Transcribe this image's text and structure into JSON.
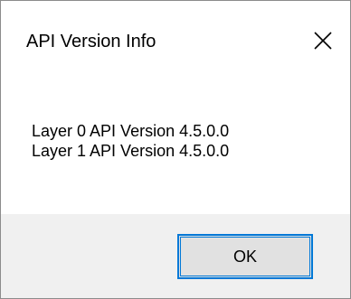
{
  "window": {
    "title": "API Version Info",
    "close_icon": "close-x-icon"
  },
  "content": {
    "lines": [
      "Layer 0 API Version 4.5.0.0",
      "Layer 1 API Version 4.5.0.0"
    ]
  },
  "footer": {
    "ok_label": "OK"
  },
  "colors": {
    "focus_border": "#0078d7",
    "button_face": "#e1e1e1",
    "footer_bg": "#f0f0f0"
  }
}
